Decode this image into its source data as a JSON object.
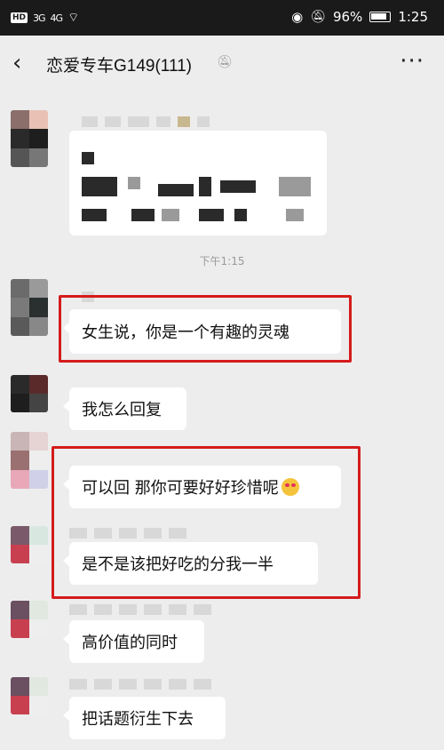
{
  "status_bar": {
    "hd_label": "HD",
    "signal1": "3G",
    "signal2": "4G",
    "battery": "96%",
    "time": "1:25"
  },
  "header": {
    "title": "恋爱专车G149(111)",
    "back_icon": "chevron-left-icon",
    "mute_icon": "bell-off-icon",
    "more_label": "···"
  },
  "timestamp": "下午1:15",
  "messages": [
    {
      "text": "女生说，你是一个有趣的灵魂"
    },
    {
      "text": "我怎么回复"
    },
    {
      "text": "可以回 那你可要好好珍惜呢"
    },
    {
      "text": "是不是该把好吃的分我一半"
    },
    {
      "text": "高价值的同时"
    },
    {
      "text": "把话题衍生下去"
    }
  ],
  "colors": {
    "highlight": "#d51b1b",
    "background": "#ededed",
    "bubble": "#ffffff"
  }
}
